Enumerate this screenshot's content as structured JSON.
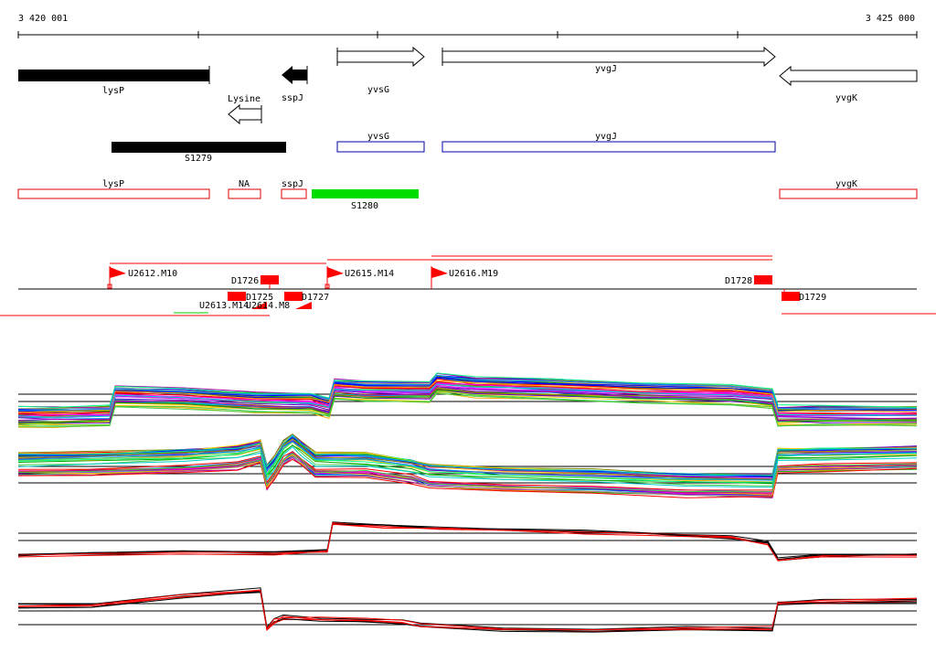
{
  "ruler": {
    "start_label": "3 420 001",
    "end_label": "3 425 000"
  },
  "genes": [
    {
      "name": "lysP",
      "strand": "-",
      "style": "black"
    },
    {
      "name": "sspJ",
      "strand": "-",
      "style": "black"
    },
    {
      "name": "Lysine",
      "strand": "-",
      "style": "open"
    },
    {
      "name": "yvsG",
      "strand": "+",
      "style": "open"
    },
    {
      "name": "yvgJ",
      "strand": "+",
      "style": "open"
    },
    {
      "name": "yvgK",
      "strand": "-",
      "style": "open"
    }
  ],
  "track2": [
    {
      "name": "S1279",
      "color": "#000000"
    },
    {
      "name": "yvsG",
      "color": "#0000aa"
    },
    {
      "name": "yvgJ",
      "color": "#0000aa"
    }
  ],
  "track3": [
    {
      "name": "lysP",
      "color": "#dd0000"
    },
    {
      "name": "NA",
      "color": "#dd0000"
    },
    {
      "name": "sspJ",
      "color": "#dd0000"
    },
    {
      "name": "S1280",
      "color": "#00dd00"
    },
    {
      "name": "yvgK",
      "color": "#dd0000"
    }
  ],
  "upstream_flags": [
    "U2612.M10",
    "U2615.M14",
    "U2616.M19",
    "U2613.M14",
    "U2614.M8"
  ],
  "downstream_boxes": [
    "D1726",
    "D1725",
    "D1727",
    "D1728",
    "D1729"
  ],
  "colors": {
    "feature_red": "#ff0000",
    "gene_blue": "#0000aa",
    "green": "#00dd00",
    "black": "#000000"
  }
}
